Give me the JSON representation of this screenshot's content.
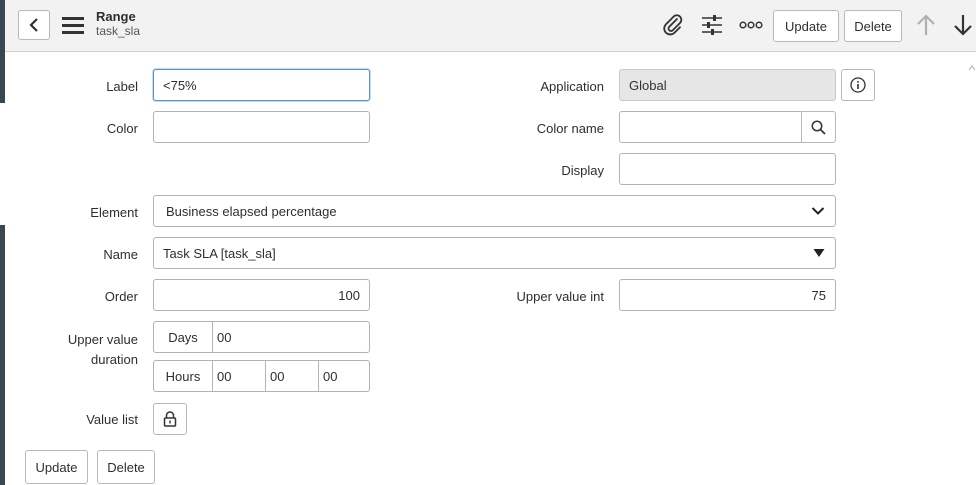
{
  "header": {
    "title": "Range",
    "subtitle": "task_sla",
    "update_label": "Update",
    "delete_label": "Delete",
    "icons": [
      "back-icon",
      "menu-icon",
      "paperclip-icon",
      "sliders-icon",
      "more-icon",
      "arrow-up-icon",
      "arrow-down-icon"
    ]
  },
  "form": {
    "label": {
      "label": "Label",
      "value": "<75%"
    },
    "application": {
      "label": "Application",
      "value": "Global"
    },
    "color": {
      "label": "Color",
      "value": ""
    },
    "color_name": {
      "label": "Color name",
      "value": ""
    },
    "display": {
      "label": "Display",
      "value": ""
    },
    "element": {
      "label": "Element",
      "value": "Business elapsed percentage"
    },
    "name": {
      "label": "Name",
      "value": "Task SLA [task_sla]"
    },
    "order": {
      "label": "Order",
      "value": "100"
    },
    "upper_value_int": {
      "label": "Upper value int",
      "value": "75"
    },
    "upper_value_duration": {
      "label_line1": "Upper value",
      "label_line2": "duration",
      "days_label": "Days",
      "days_value": "00",
      "hours_label": "Hours",
      "hours_value": "00",
      "minutes_value": "00",
      "seconds_value": "00"
    },
    "value_list": {
      "label": "Value list"
    }
  },
  "footer": {
    "update_label": "Update",
    "delete_label": "Delete"
  },
  "colors": {
    "header_bg": "#f2f2f2",
    "focus_border": "#5d93c7",
    "readonly_bg": "#e6e6e6",
    "sidebar": "#3b4750"
  }
}
